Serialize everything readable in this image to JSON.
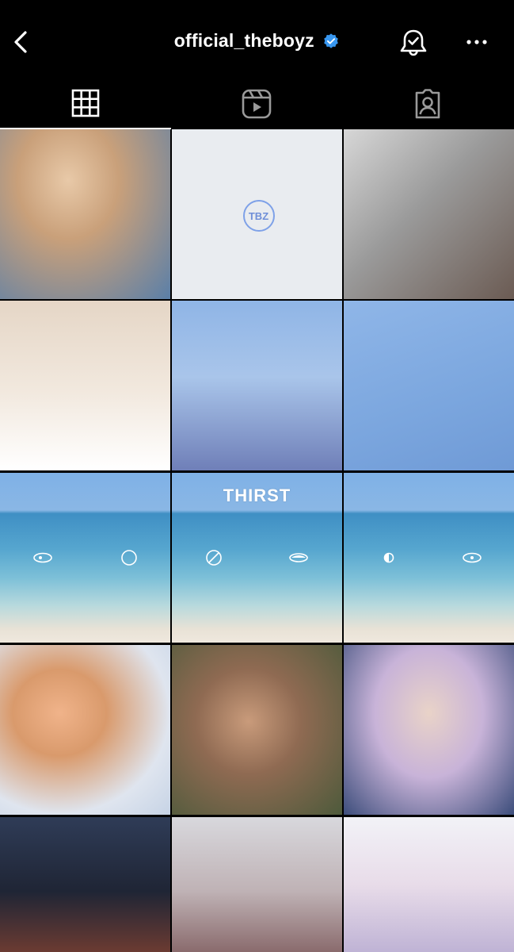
{
  "header": {
    "username": "official_theboyz",
    "verified": true,
    "back_icon": "chevron-left-icon",
    "notify_icon": "bell-check-icon",
    "more_icon": "more-horizontal-icon"
  },
  "tabs": [
    {
      "name": "grid",
      "icon": "grid-icon",
      "active": true
    },
    {
      "name": "reels",
      "icon": "reels-icon",
      "active": false
    },
    {
      "name": "tagged",
      "icon": "tagged-user-icon",
      "active": false
    }
  ],
  "posts": [
    {
      "id": 1,
      "kind": "photo"
    },
    {
      "id": 2,
      "kind": "logo",
      "badge_text": "TBZ"
    },
    {
      "id": 3,
      "kind": "photo"
    },
    {
      "id": 4,
      "kind": "photo"
    },
    {
      "id": 5,
      "kind": "photo"
    },
    {
      "id": 6,
      "kind": "photo"
    },
    {
      "id": 7,
      "kind": "sea"
    },
    {
      "id": 8,
      "kind": "sea",
      "overlay_text": "THIRST"
    },
    {
      "id": 9,
      "kind": "sea"
    },
    {
      "id": 10,
      "kind": "photo"
    },
    {
      "id": 11,
      "kind": "photo"
    },
    {
      "id": 12,
      "kind": "photo"
    },
    {
      "id": 13,
      "kind": "photo"
    },
    {
      "id": 14,
      "kind": "photo"
    },
    {
      "id": 15,
      "kind": "photo"
    }
  ],
  "colors": {
    "background": "#000000",
    "text": "#ffffff",
    "verified_blue": "#3897f0",
    "logo_blue": "#7ea1e8"
  }
}
